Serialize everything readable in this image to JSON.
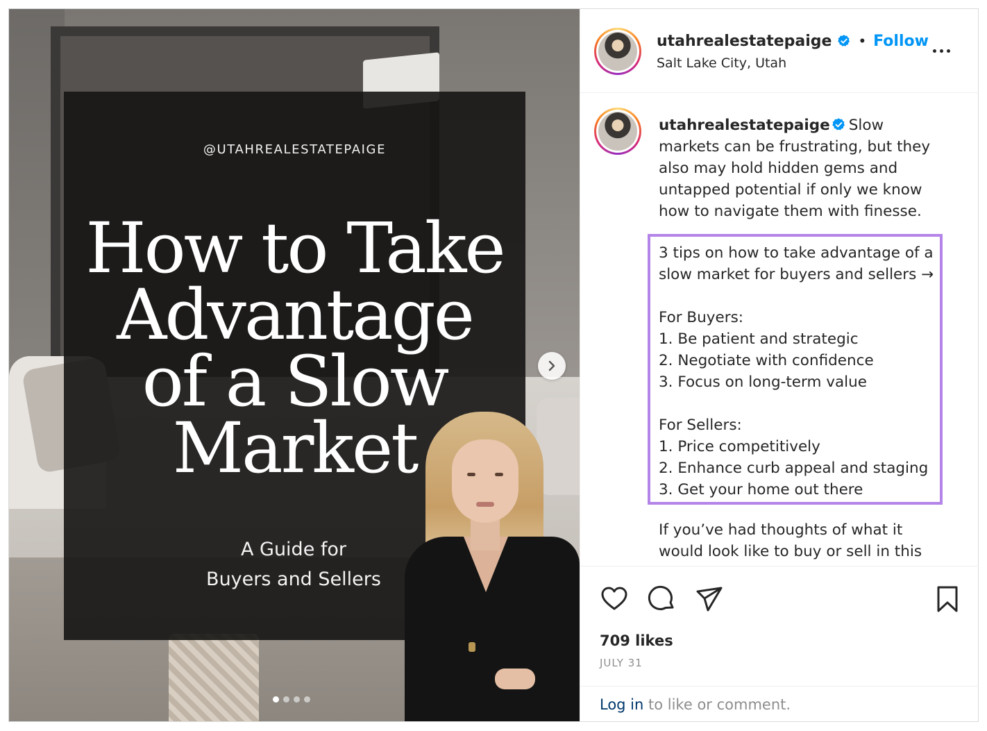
{
  "post": {
    "media": {
      "handle": "@UTAHREALESTATEPAIGE",
      "headline_lines": [
        "How to Take",
        "Advantage",
        "of a Slow",
        "Market"
      ],
      "subtitle_lines": [
        "A Guide for",
        "Buyers and Sellers"
      ],
      "carousel_count": 4,
      "carousel_active": 1
    },
    "header": {
      "username": "utahrealestatepaige",
      "bullet": "•",
      "follow_label": "Follow",
      "location": "Salt Lake City, Utah"
    },
    "caption": {
      "username": "utahrealestatepaige",
      "intro": "Slow markets can be frustrating, but they also may hold hidden gems and untapped potential if only we know how to navigate them with finesse.",
      "tips": [
        "3 tips on how to take advantage of a",
        "slow market for buyers and sellers →",
        "",
        "For Buyers:",
        "1. Be patient and strategic",
        "2. Negotiate with confidence",
        "3. Focus on long-term value",
        "",
        "For Sellers:",
        "1. Price competitively",
        "2. Enhance curb appeal and staging",
        "3. Get your home out there"
      ],
      "continuation": "If you’ve had thoughts of what it would look like to buy or sell in this"
    },
    "stats": {
      "likes": "709 likes",
      "date": "JULY 31"
    },
    "login": {
      "link": "Log in",
      "rest": " to like or comment."
    },
    "colors": {
      "follow": "#0095f6",
      "highlight_border": "#b584e8",
      "verified": "#0095f6"
    },
    "icons": [
      "verified-badge-icon",
      "more-options-icon",
      "chevron-right-icon",
      "heart-icon",
      "comment-icon",
      "share-icon",
      "bookmark-icon"
    ]
  }
}
